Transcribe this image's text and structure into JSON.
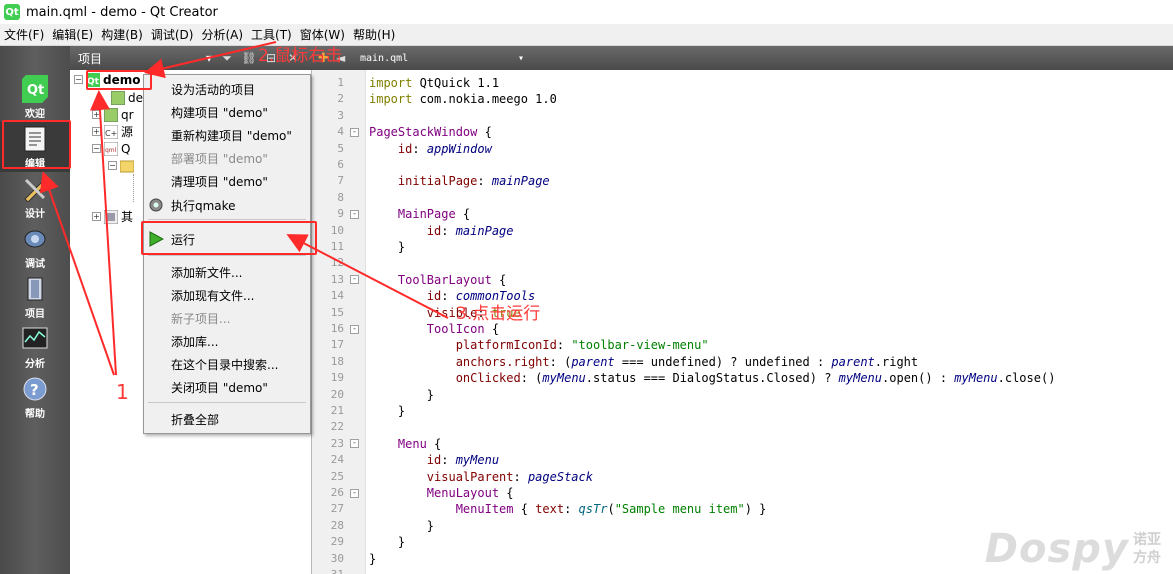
{
  "window": {
    "title": "main.qml - demo - Qt Creator",
    "icon": "qt-logo-icon"
  },
  "menubar": [
    "文件(F)",
    "编辑(E)",
    "构建(B)",
    "调试(D)",
    "分析(A)",
    "工具(T)",
    "窗体(W)",
    "帮助(H)"
  ],
  "modes": [
    {
      "label": "欢迎",
      "icon": "qt-logo-icon"
    },
    {
      "label": "编辑",
      "icon": "edit-document-icon"
    },
    {
      "label": "设计",
      "icon": "design-pencil-icon"
    },
    {
      "label": "调试",
      "icon": "debug-bug-icon"
    },
    {
      "label": "项目",
      "icon": "projects-wrench-icon"
    },
    {
      "label": "分析",
      "icon": "analyze-monitor-icon"
    },
    {
      "label": "帮助",
      "icon": "help-question-icon"
    }
  ],
  "projects_pane": {
    "selector": "项目",
    "tree": [
      {
        "label": "demo",
        "icon": "qt-project-icon"
      },
      {
        "label": "de",
        "icon": "pro-file-icon"
      },
      {
        "label": "qr",
        "icon": "folder-icon"
      },
      {
        "label": "源",
        "icon": "source-folder-icon"
      },
      {
        "label": "Q",
        "icon": "qml-folder-icon"
      },
      {
        "label": "其",
        "icon": "other-folder-icon"
      }
    ]
  },
  "context_menu": {
    "items": [
      {
        "label": "设为活动的项目",
        "enabled": true
      },
      {
        "label": "构建项目 \"demo\"",
        "enabled": true
      },
      {
        "label": "重新构建项目 \"demo\"",
        "enabled": true
      },
      {
        "label": "部署项目 \"demo\"",
        "enabled": false
      },
      {
        "label": "清理项目 \"demo\"",
        "enabled": true
      },
      {
        "label": "执行qmake",
        "enabled": true,
        "icon": "qmake-gear-icon"
      },
      {
        "label": "运行",
        "enabled": true,
        "icon": "run-play-icon"
      },
      {
        "label": "添加新文件...",
        "enabled": true
      },
      {
        "label": "添加现有文件...",
        "enabled": true
      },
      {
        "label": "新子项目...",
        "enabled": false
      },
      {
        "label": "添加库...",
        "enabled": true
      },
      {
        "label": "在这个目录中搜索...",
        "enabled": true
      },
      {
        "label": "关闭项目 \"demo\"",
        "enabled": true
      },
      {
        "label": "折叠全部",
        "enabled": true
      }
    ]
  },
  "editor": {
    "file": "main.qml",
    "line_numbers": [
      "1",
      "2",
      "3",
      "4",
      "5",
      "6",
      "7",
      "8",
      "9",
      "10",
      "11",
      "12",
      "13",
      "14",
      "15",
      "16",
      "17",
      "18",
      "19",
      "20",
      "21",
      "22",
      "23",
      "24",
      "25",
      "26",
      "27",
      "28",
      "29",
      "30",
      "31"
    ],
    "fold_markers": [
      "-",
      "-",
      "-",
      "-",
      "-",
      "-",
      "-",
      "-"
    ]
  },
  "annotations": {
    "step1": "1",
    "step2": "2.鼠标右击",
    "step3": "3.点击运行"
  },
  "watermark": {
    "brand": "Dospy",
    "chinese": [
      "诺亚",
      "方舟"
    ]
  },
  "colors": {
    "annotation": "#ff2a2a",
    "sidebar": "#555555",
    "header": "#5a5a5a"
  }
}
